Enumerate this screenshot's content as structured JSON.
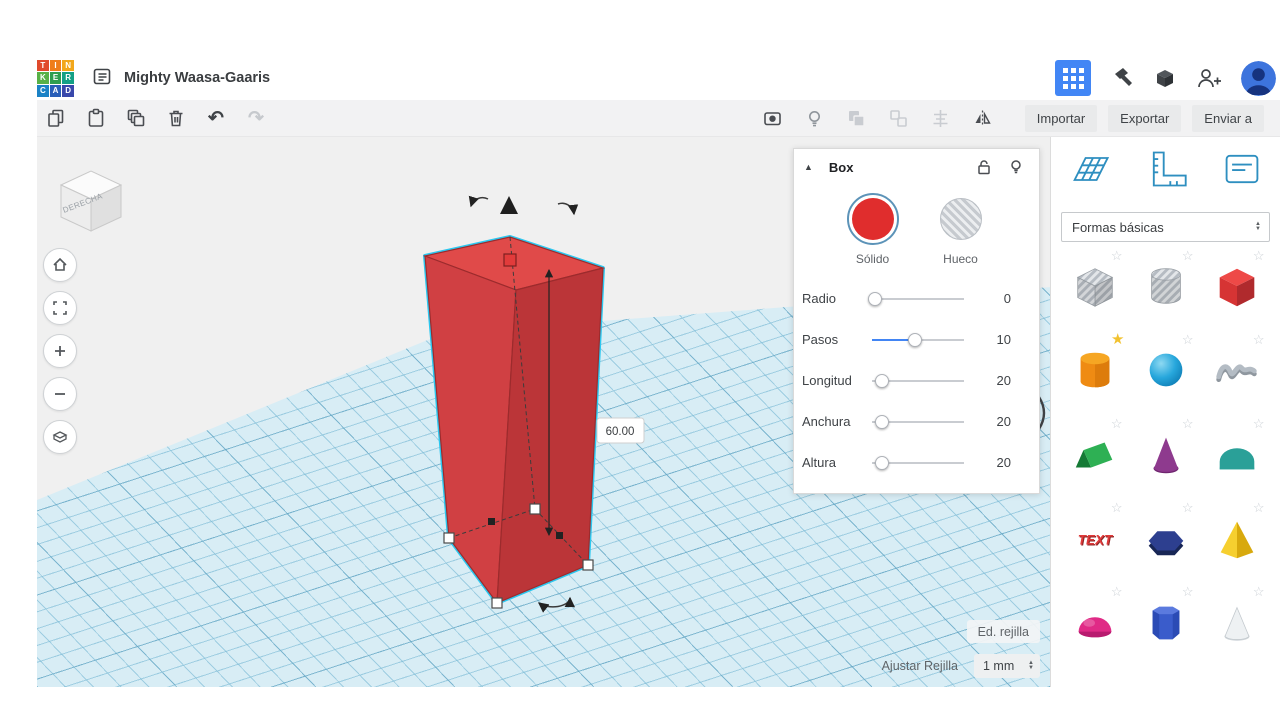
{
  "colors": {
    "accent_blue": "#4286f5",
    "selection_cyan": "#2bc8f0",
    "shape_red": "#d04043",
    "workplane_blue": "#d8edf5"
  },
  "header": {
    "title": "Mighty Waasa-Gaaris",
    "logo_letters": [
      "T",
      "I",
      "N",
      "K",
      "E",
      "R",
      "C",
      "A",
      "D"
    ],
    "icons": [
      "apps-grid",
      "hammer",
      "blocks",
      "invite-user",
      "avatar"
    ]
  },
  "toolbar": {
    "left_icons": [
      "copy",
      "paste",
      "duplicate",
      "delete",
      "undo",
      "redo"
    ],
    "right_icons": [
      "show-all",
      "light-bulb",
      "group",
      "ungroup",
      "align",
      "mirror"
    ],
    "import_label": "Importar",
    "export_label": "Exportar",
    "send_label": "Enviar a"
  },
  "viewport": {
    "viewcube_label": "DERECHA",
    "dimension_value": "60.00",
    "edit_grid_label": "Ed. rejilla",
    "snap_grid_label": "Ajustar Rejilla",
    "snap_grid_value": "1 mm",
    "nav_icons": [
      "home",
      "fit-view",
      "zoom-in",
      "zoom-out",
      "perspective"
    ]
  },
  "inspector": {
    "title": "Box",
    "solid_label": "Sólido",
    "hole_label": "Hueco",
    "fields": [
      {
        "label": "Radio",
        "value": "0"
      },
      {
        "label": "Pasos",
        "value": "10"
      },
      {
        "label": "Longitud",
        "value": "20"
      },
      {
        "label": "Anchura",
        "value": "20"
      },
      {
        "label": "Altura",
        "value": "20"
      }
    ]
  },
  "shapes_panel": {
    "category_label": "Formas básicas",
    "tool_icons": [
      "workplane",
      "ruler",
      "notes"
    ],
    "shapes": [
      {
        "name": "striped-box"
      },
      {
        "name": "striped-cylinder"
      },
      {
        "name": "red-box"
      },
      {
        "name": "orange-cylinder",
        "favorite": true
      },
      {
        "name": "blue-sphere"
      },
      {
        "name": "gray-scribble"
      },
      {
        "name": "green-roof"
      },
      {
        "name": "purple-cone"
      },
      {
        "name": "teal-round-roof"
      },
      {
        "name": "red-text",
        "label": "TEXT"
      },
      {
        "name": "navy-polygon"
      },
      {
        "name": "yellow-pyramid"
      },
      {
        "name": "pink-half-sphere"
      },
      {
        "name": "blue-hex-prism"
      },
      {
        "name": "white-cone"
      }
    ]
  }
}
